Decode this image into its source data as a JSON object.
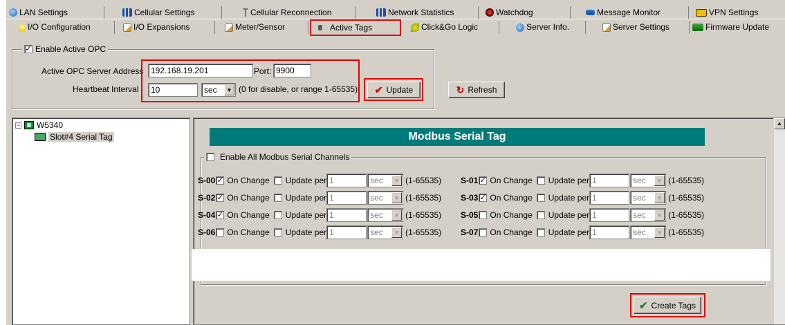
{
  "tabs_row1": [
    {
      "label": "LAN Settings",
      "icon": "globe-icon"
    },
    {
      "label": "Cellular Settings",
      "icon": "signal-bars-icon"
    },
    {
      "label": "Cellular Reconnection",
      "icon": "antenna-icon"
    },
    {
      "label": "Network Statistics",
      "icon": "signal-bars-icon"
    },
    {
      "label": "Watchdog",
      "icon": "watchdog-icon"
    },
    {
      "label": "Message Monitor",
      "icon": "message-icon"
    },
    {
      "label": "VPN Settings",
      "icon": "vpn-icon"
    }
  ],
  "tabs_row2": [
    {
      "label": "I/O Configuration",
      "icon": "bulb-icon"
    },
    {
      "label": "I/O Expansions",
      "icon": "document-edit-icon"
    },
    {
      "label": "Meter/Sensor",
      "icon": "document-edit-icon"
    },
    {
      "label": "Active Tags",
      "icon": "tag-icon",
      "active": true
    },
    {
      "label": "Click&Go Logic",
      "icon": "logic-icon"
    },
    {
      "label": "Server Info.",
      "icon": "globe-icon"
    },
    {
      "label": "Server Settings",
      "icon": "document-edit-icon"
    },
    {
      "label": "Firmware Update",
      "icon": "firmware-icon"
    }
  ],
  "opc": {
    "enable_label": "Enable Active OPC",
    "enable_checked": true,
    "server_address_label": "Active OPC Server Address",
    "server_address": "192.168.19.201",
    "port_label": "Port:",
    "port": "9900",
    "heartbeat_label": "Heartbeat Interval :",
    "heartbeat": "10",
    "heartbeat_unit": "sec",
    "heartbeat_hint": "(0 for disable, or range 1-65535)",
    "update_button": "Update",
    "refresh_button": "Refresh"
  },
  "tree": {
    "root": "W5340",
    "child": "Slot#4 Serial Tag"
  },
  "modbus": {
    "title": "Modbus Serial Tag",
    "enable_all_label": "Enable All Modbus Serial Channels",
    "on_change_label": "On Change",
    "update_per_label": "Update per",
    "range_label": "(1-65535)",
    "unit": "sec",
    "channels": [
      {
        "id": "S-00",
        "on_change": true,
        "update_per": false,
        "interval": "1"
      },
      {
        "id": "S-01",
        "on_change": true,
        "update_per": false,
        "interval": "1"
      },
      {
        "id": "S-02",
        "on_change": true,
        "update_per": false,
        "interval": "1"
      },
      {
        "id": "S-03",
        "on_change": true,
        "update_per": false,
        "interval": "1"
      },
      {
        "id": "S-04",
        "on_change": true,
        "update_per": false,
        "interval": "1"
      },
      {
        "id": "S-05",
        "on_change": false,
        "update_per": false,
        "interval": "1"
      },
      {
        "id": "S-06",
        "on_change": false,
        "update_per": false,
        "interval": "1"
      },
      {
        "id": "S-07",
        "on_change": false,
        "update_per": false,
        "interval": "1"
      }
    ],
    "create_button": "Create Tags"
  }
}
